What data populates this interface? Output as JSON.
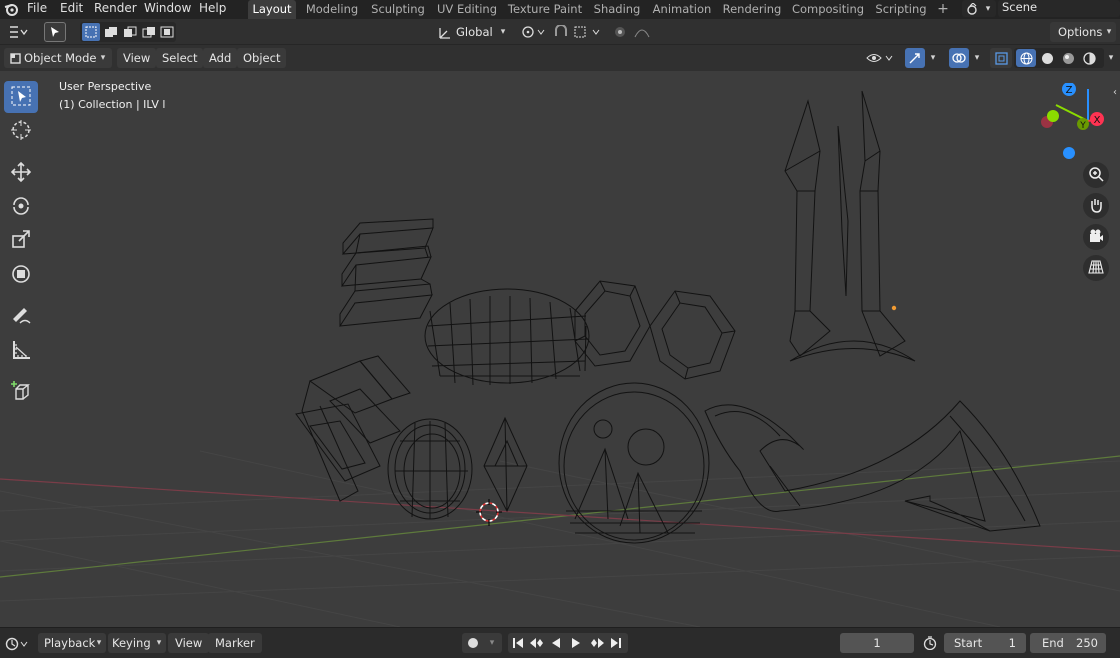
{
  "menubar": {
    "items": [
      "File",
      "Edit",
      "Render",
      "Window",
      "Help"
    ]
  },
  "workspaces": {
    "tabs": [
      "Layout",
      "Modeling",
      "Sculpting",
      "UV Editing",
      "Texture Paint",
      "Shading",
      "Animation",
      "Rendering",
      "Compositing",
      "Scripting"
    ],
    "add": "+"
  },
  "scene": {
    "label": "Scene"
  },
  "toolheader": {
    "orientation": "Global",
    "options": "Options"
  },
  "viewport_header": {
    "mode": "Object Mode",
    "menus": [
      "View",
      "Select",
      "Add",
      "Object"
    ]
  },
  "viewport": {
    "perspective": "User Perspective",
    "collection": "(1) Collection | ILV l"
  },
  "gizmo": {
    "x": "X",
    "y": "Y",
    "z": "Z"
  },
  "timeline": {
    "menus": [
      "Playback",
      "Keying",
      "View",
      "Marker"
    ],
    "current_frame": "1",
    "start_label": "Start",
    "start_value": "1",
    "end_label": "End",
    "end_value": "250"
  },
  "colors": {
    "accent": "#4772b3",
    "active_tab": "#3d3d3d",
    "x_axis": "#ff3352",
    "y_axis": "#8bdc00",
    "z_axis": "#2890ff"
  }
}
